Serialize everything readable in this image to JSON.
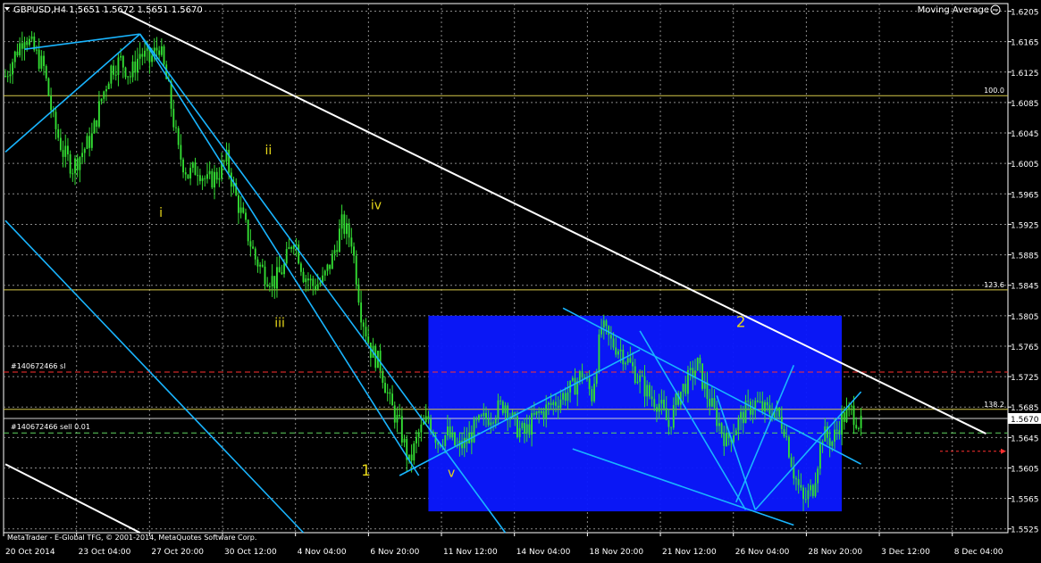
{
  "header": {
    "symbol_line": "GBPUSD,H4  1.5651 1.5672 1.5651 1.5670",
    "indicator": "Moving Average"
  },
  "footer": {
    "copyright": "MetaTrader - E-Global TFG, © 2001-2014, MetaQuotes Software Corp."
  },
  "colors": {
    "background": "#000000",
    "grid": "#8a8a8a",
    "candle": "#33dd33",
    "channel": "#19b5ff",
    "trendline": "#ffffff",
    "box": "#0a18ff",
    "wave_label": "#e8d81a",
    "fib": "#d6c94a",
    "sl": "#ff3030",
    "order": "#5fd35f"
  },
  "chart_data": {
    "type": "candlestick",
    "title": "GBPUSD,H4",
    "ohlc_readout": {
      "open": 1.5651,
      "high": 1.5672,
      "low": 1.5651,
      "close": 1.567
    },
    "current_price": 1.567,
    "ylim": [
      1.552,
      1.6215
    ],
    "y_ticks": [
      "1.6205",
      "1.6165",
      "1.6125",
      "1.6085",
      "1.6045",
      "1.6005",
      "1.5965",
      "1.5925",
      "1.5885",
      "1.5845",
      "1.5805",
      "1.5765",
      "1.5725",
      "1.5685",
      "1.5645",
      "1.5605",
      "1.5565",
      "1.5525"
    ],
    "x_ticks": [
      "20 Oct 2014",
      "23 Oct 04:00",
      "27 Oct 20:00",
      "30 Oct 12:00",
      "4 Nov 04:00",
      "6 Nov 20:00",
      "11 Nov 12:00",
      "14 Nov 04:00",
      "18 Nov 20:00",
      "21 Nov 12:00",
      "26 Nov 04:00",
      "28 Nov 20:00",
      "3 Dec 12:00",
      "8 Dec 04:00"
    ],
    "grid": true,
    "price_path": [
      [
        0,
        1.612
      ],
      [
        2,
        1.6175
      ],
      [
        4,
        1.613
      ],
      [
        5,
        1.606
      ],
      [
        6,
        1.602
      ],
      [
        7,
        1.6
      ],
      [
        9,
        1.604
      ],
      [
        10,
        1.609
      ],
      [
        11,
        1.613
      ],
      [
        12,
        1.614
      ],
      [
        13,
        1.612
      ],
      [
        14,
        1.615
      ],
      [
        15,
        1.614
      ],
      [
        16,
        1.616
      ],
      [
        17,
        1.61
      ],
      [
        18,
        1.602
      ],
      [
        19,
        1.599
      ],
      [
        20,
        1.6
      ],
      [
        21,
        1.598
      ],
      [
        22,
        1.599
      ],
      [
        23,
        1.601
      ],
      [
        24,
        1.596
      ],
      [
        25,
        1.592
      ],
      [
        26,
        1.588
      ],
      [
        27,
        1.586
      ],
      [
        28,
        1.585
      ],
      [
        29,
        1.587
      ],
      [
        30,
        1.591
      ],
      [
        31,
        1.586
      ],
      [
        32,
        1.5845
      ],
      [
        33,
        1.585
      ],
      [
        34,
        1.588
      ],
      [
        35,
        1.5925
      ],
      [
        36,
        1.5905
      ],
      [
        37,
        1.581
      ],
      [
        38,
        1.576
      ],
      [
        39,
        1.574
      ],
      [
        40,
        1.569
      ],
      [
        41,
        1.566
      ],
      [
        42,
        1.561
      ],
      [
        43,
        1.565
      ],
      [
        44,
        1.567
      ],
      [
        45,
        1.564
      ],
      [
        46,
        1.565
      ],
      [
        47,
        1.563
      ],
      [
        48,
        1.564
      ],
      [
        49,
        1.566
      ],
      [
        50,
        1.567
      ],
      [
        51,
        1.568
      ],
      [
        52,
        1.569
      ],
      [
        53,
        1.566
      ],
      [
        54,
        1.565
      ],
      [
        55,
        1.567
      ],
      [
        56,
        1.568
      ],
      [
        57,
        1.569
      ],
      [
        58,
        1.57
      ],
      [
        59,
        1.571
      ],
      [
        60,
        1.573
      ],
      [
        61,
        1.57
      ],
      [
        62,
        1.579
      ],
      [
        63,
        1.577
      ],
      [
        64,
        1.576
      ],
      [
        65,
        1.574
      ],
      [
        66,
        1.572
      ],
      [
        67,
        1.57
      ],
      [
        68,
        1.569
      ],
      [
        69,
        1.566
      ],
      [
        70,
        1.57
      ],
      [
        71,
        1.572
      ],
      [
        72,
        1.574
      ],
      [
        73,
        1.57
      ],
      [
        74,
        1.567
      ],
      [
        75,
        1.564
      ],
      [
        76,
        1.566
      ],
      [
        77,
        1.568
      ],
      [
        78,
        1.569
      ],
      [
        79,
        1.568
      ],
      [
        80,
        1.568
      ],
      [
        81,
        1.566
      ],
      [
        82,
        1.56
      ],
      [
        83,
        1.556
      ],
      [
        84,
        1.558
      ],
      [
        85,
        1.565
      ],
      [
        86,
        1.564
      ],
      [
        87,
        1.567
      ],
      [
        88,
        1.568
      ],
      [
        89,
        1.566
      ]
    ],
    "price_lines": [
      {
        "label": "100.0",
        "price": 1.6094,
        "kind": "fib"
      },
      {
        "label": "123.6",
        "price": 1.5839,
        "kind": "fib"
      },
      {
        "label": "138.2",
        "price": 1.5682,
        "kind": "fib"
      },
      {
        "label": "#140672466 sl",
        "price": 1.5731,
        "kind": "sl"
      },
      {
        "label": "#140672466 sell 0.01",
        "price": 1.5651,
        "kind": "order"
      }
    ],
    "wave_labels": [
      {
        "text": "i",
        "bar": 16,
        "price": 1.5935,
        "size": "small"
      },
      {
        "text": "ii",
        "bar": 27,
        "price": 1.6017,
        "size": "small"
      },
      {
        "text": "iii",
        "bar": 28,
        "price": 1.579,
        "size": "small"
      },
      {
        "text": "iv",
        "bar": 38,
        "price": 1.5945,
        "size": "small"
      },
      {
        "text": "1",
        "bar": 37,
        "price": 1.5595,
        "size": "large"
      },
      {
        "text": "v",
        "bar": 46,
        "price": 1.5593,
        "size": "small"
      },
      {
        "text": "2",
        "bar": 76,
        "price": 1.579,
        "size": "large"
      }
    ],
    "rectangle": {
      "bar_from": 44,
      "bar_to": 87,
      "price_from": 1.5805,
      "price_to": 1.5548
    },
    "trendlines": [
      {
        "kind": "white",
        "from": [
          12,
          1.6205
        ],
        "to": [
          102,
          1.565
        ]
      },
      {
        "kind": "white",
        "from": [
          0,
          1.561
        ],
        "to": [
          14,
          1.552
        ]
      },
      {
        "kind": "channel",
        "from": [
          2,
          1.6155
        ],
        "to": [
          14,
          1.6175
        ]
      },
      {
        "kind": "channel",
        "from": [
          0,
          1.602
        ],
        "to": [
          14,
          1.6175
        ]
      },
      {
        "kind": "channel",
        "from": [
          14,
          1.6175
        ],
        "to": [
          43,
          1.5595
        ]
      },
      {
        "kind": "channel",
        "from": [
          14,
          1.6175
        ],
        "to": [
          52,
          1.552
        ]
      },
      {
        "kind": "channel",
        "from": [
          0,
          1.593
        ],
        "to": [
          31,
          1.552
        ]
      },
      {
        "kind": "channel",
        "from": [
          41,
          1.5595
        ],
        "to": [
          66,
          1.576
        ]
      },
      {
        "kind": "channel",
        "from": [
          58,
          1.5815
        ],
        "to": [
          89,
          1.561
        ]
      },
      {
        "kind": "channel",
        "from": [
          59,
          1.563
        ],
        "to": [
          82,
          1.553
        ]
      },
      {
        "kind": "channel",
        "from": [
          66,
          1.5785
        ],
        "to": [
          77,
          1.555
        ]
      },
      {
        "kind": "channel",
        "from": [
          74,
          1.57
        ],
        "to": [
          78,
          1.555
        ]
      },
      {
        "kind": "channel",
        "from": [
          76,
          1.556
        ],
        "to": [
          82,
          1.574
        ]
      },
      {
        "kind": "channel",
        "from": [
          78,
          1.555
        ],
        "to": [
          89,
          1.5705
        ]
      }
    ],
    "marker": {
      "label": "arrow",
      "price": 1.5627
    }
  }
}
